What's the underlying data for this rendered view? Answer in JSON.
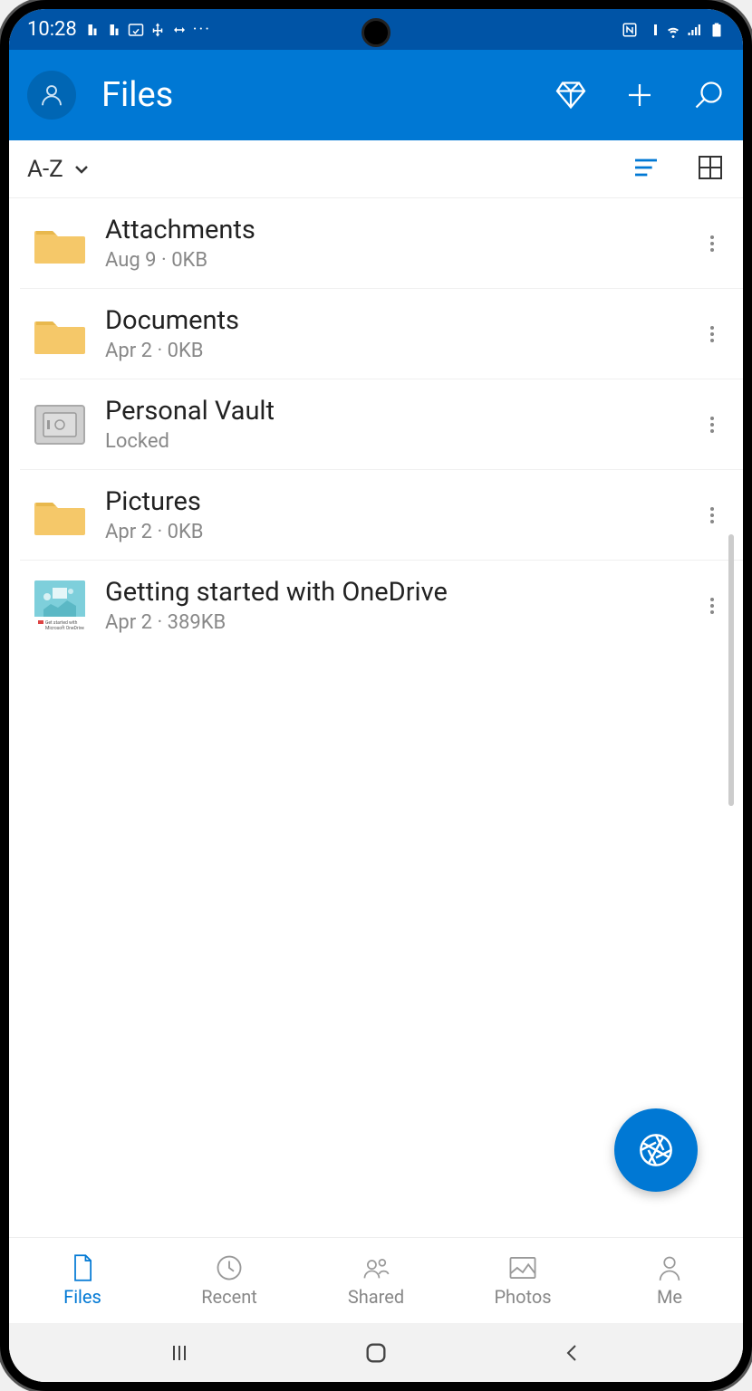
{
  "statusBar": {
    "time": "10:28",
    "leftIcons": [
      "m1",
      "m2",
      "cast",
      "usb",
      "transfer",
      "more"
    ],
    "rightIcons": [
      "nfc",
      "vibrate",
      "wifi",
      "signal",
      "battery"
    ]
  },
  "header": {
    "title": "Files"
  },
  "filter": {
    "sortLabel": "A-Z"
  },
  "files": [
    {
      "name": "Attachments",
      "meta": "Aug 9 · 0KB",
      "type": "folder"
    },
    {
      "name": "Documents",
      "meta": "Apr 2 · 0KB",
      "type": "folder"
    },
    {
      "name": "Personal Vault",
      "meta": "Locked",
      "type": "vault"
    },
    {
      "name": "Pictures",
      "meta": "Apr 2 · 0KB",
      "type": "folder"
    },
    {
      "name": "Getting started with OneDrive",
      "meta": "Apr 2 · 389KB",
      "type": "document"
    }
  ],
  "bottomNav": [
    {
      "label": "Files",
      "active": true
    },
    {
      "label": "Recent",
      "active": false
    },
    {
      "label": "Shared",
      "active": false
    },
    {
      "label": "Photos",
      "active": false
    },
    {
      "label": "Me",
      "active": false
    }
  ]
}
